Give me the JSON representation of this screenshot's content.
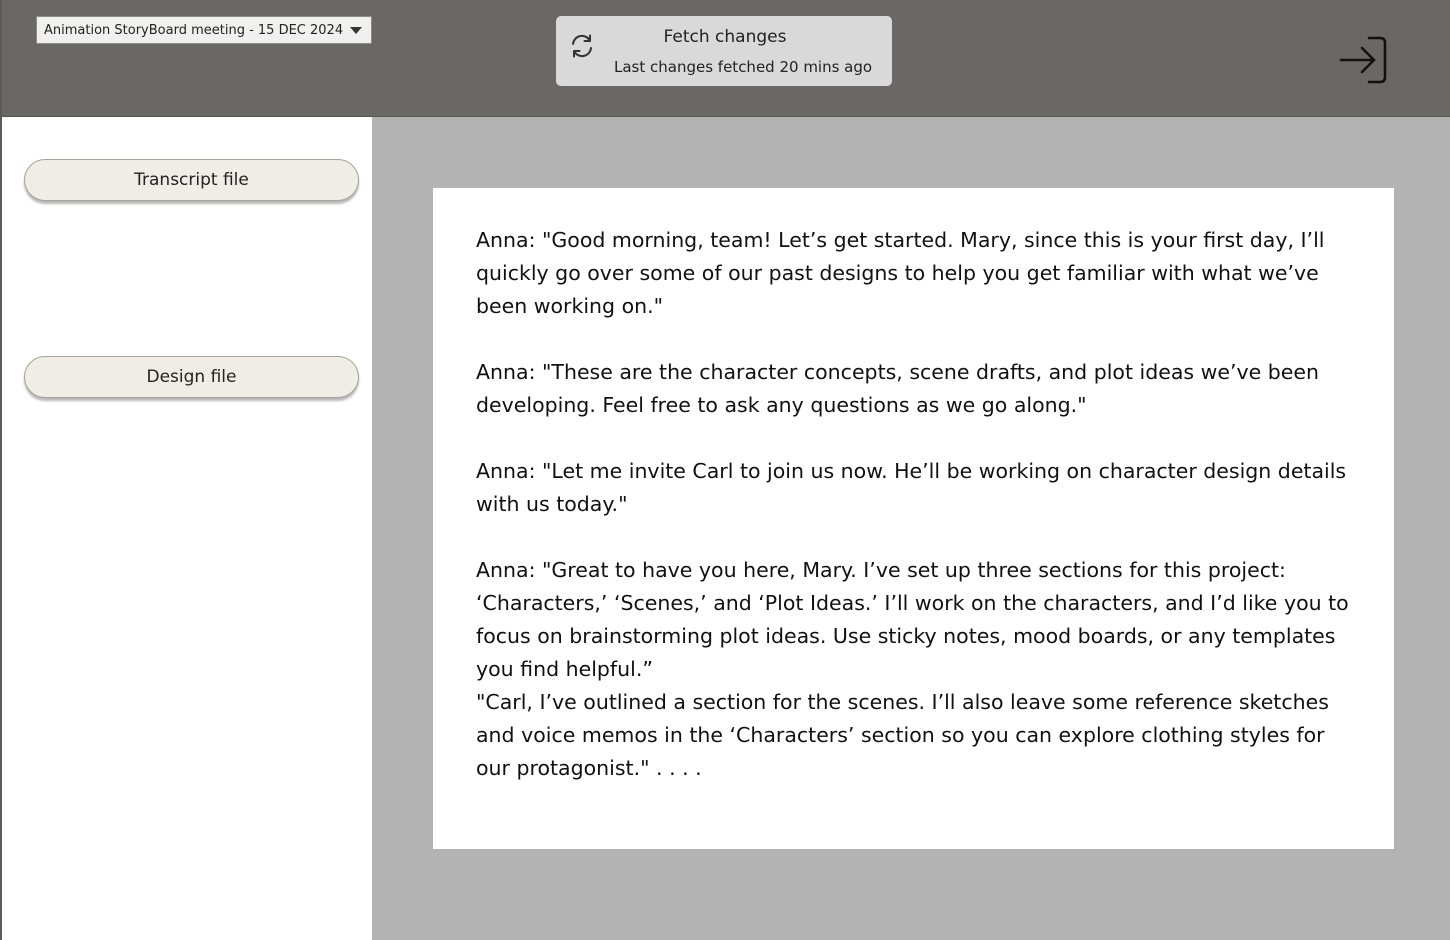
{
  "header": {
    "meeting_select_value": "Animation StoryBoard meeting - 15 DEC 2024",
    "fetch_title": "Fetch changes",
    "fetch_status": "Last changes fetched 20 mins ago"
  },
  "sidebar": {
    "buttons": [
      {
        "label": "Transcript file"
      },
      {
        "label": "Design file"
      }
    ]
  },
  "document": {
    "paragraphs": [
      "Anna: \"Good morning, team! Let’s get started. Mary, since this is your first day, I’ll quickly go over some of our past designs to help you get familiar with what we’ve been working on.\"",
      "Anna: \"These are the character concepts, scene drafts, and plot ideas we’ve been developing. Feel free to ask any questions as we go along.\"",
      "Anna: \"Let me invite Carl to join us now. He’ll be working on character design details with us today.\"",
      "Anna: \"Great to have you here, Mary. I’ve set up three sections for this project: ‘Characters,’ ‘Scenes,’ and ‘Plot Ideas.’ I’ll work on the characters, and I’d like you to focus on brainstorming plot ideas. Use sticky notes, mood boards, or any templates you find helpful.”",
      "\"Carl, I’ve outlined a section for the scenes. I’ll also leave some reference sketches and voice memos in the ‘Characters’ section so you can explore clothing styles for our protagonist.\" . . . ."
    ]
  },
  "icons": {
    "refresh": "refresh-icon",
    "exit": "sign-in-arrow-icon",
    "dropdown": "chevron-down-icon"
  },
  "colors": {
    "topbar": "#696864",
    "main_background": "#b3b3b3",
    "button_fill": "#f0ece6",
    "fetch_box": "#d9d9d9"
  }
}
